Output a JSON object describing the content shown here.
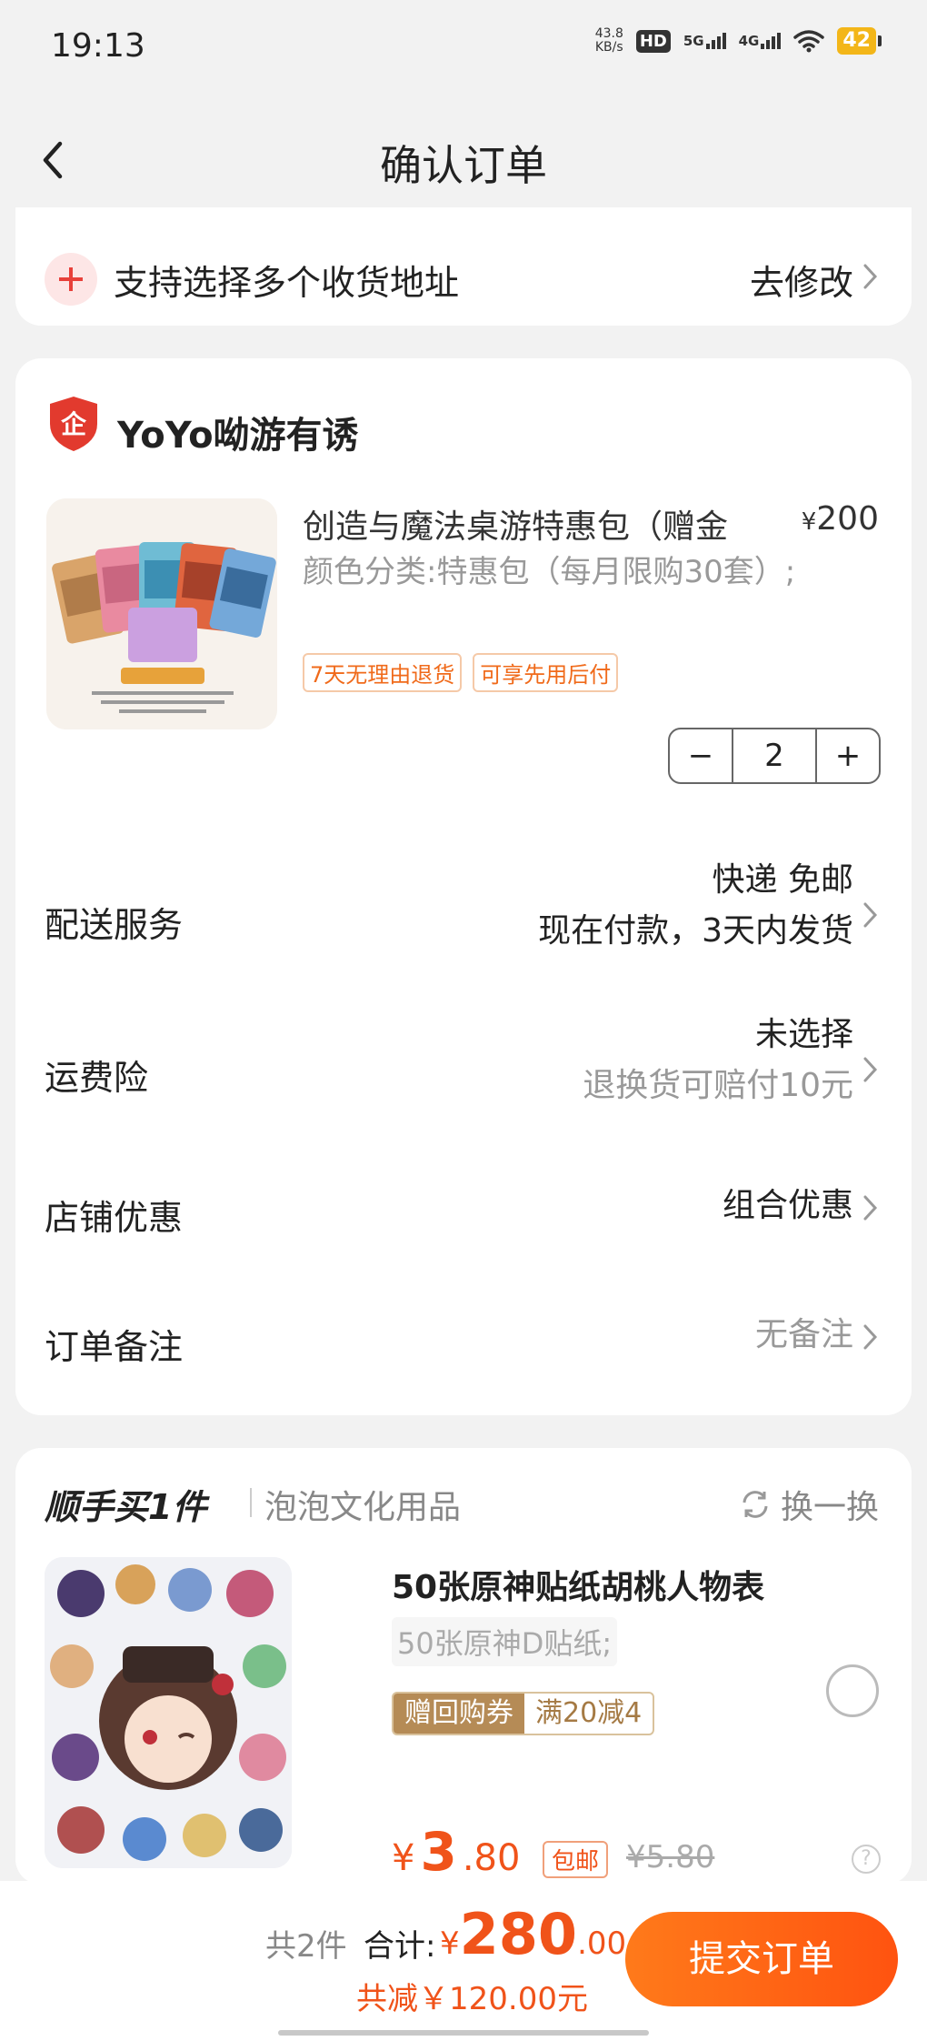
{
  "status_bar": {
    "time": "19:13",
    "net_speed": "43.8",
    "net_unit": "KB/s",
    "hd": "HD",
    "hd_sub": "1",
    "sig1": "5G",
    "sig2": "4G",
    "battery": "42"
  },
  "nav": {
    "title": "确认订单"
  },
  "address": {
    "label": "支持选择多个收货地址",
    "edit": "去修改"
  },
  "shop": {
    "name": "YoYo呦游有诱",
    "product": {
      "title": "创造与魔法桌游特惠包（赠金",
      "price_symbol": "¥",
      "price": "200",
      "spec": "颜色分类:特惠包（每月限购30套）;",
      "tags": [
        "7天无理由退货",
        "可享先用后付"
      ],
      "quantity": "2",
      "minus": "−",
      "plus": "+"
    },
    "rows": {
      "delivery": {
        "label": "配送服务",
        "line1": "快递 免邮",
        "line2": "现在付款，3天内发货"
      },
      "insurance": {
        "label": "运费险",
        "line1": "未选择",
        "line2": "退换货可赔付10元"
      },
      "discount": {
        "label": "店铺优惠",
        "value": "组合优惠"
      },
      "note": {
        "label": "订单备注",
        "value": "无备注"
      }
    }
  },
  "addon": {
    "heading": "顺手买1件",
    "shop": "泡泡文化用品",
    "swap": "换一换",
    "title": "50张原神贴纸胡桃人物表",
    "spec": "50张原神D贴纸;",
    "coupon_a": "赠回购券",
    "coupon_b": "满20减4",
    "price_symbol": "¥",
    "price_int": "3",
    "price_dec": ".80",
    "pill": "包邮",
    "orig": "¥5.80",
    "q": "?"
  },
  "bottom": {
    "count": "共2件",
    "total_label": "合计:",
    "total_symbol": "¥",
    "total_int": "280",
    "total_dec": ".00",
    "save": "共减￥120.00元",
    "submit": "提交订单"
  },
  "colors": {
    "accent": "#f0531a",
    "tag": "#f06a1a",
    "coupon": "#b58b56"
  }
}
